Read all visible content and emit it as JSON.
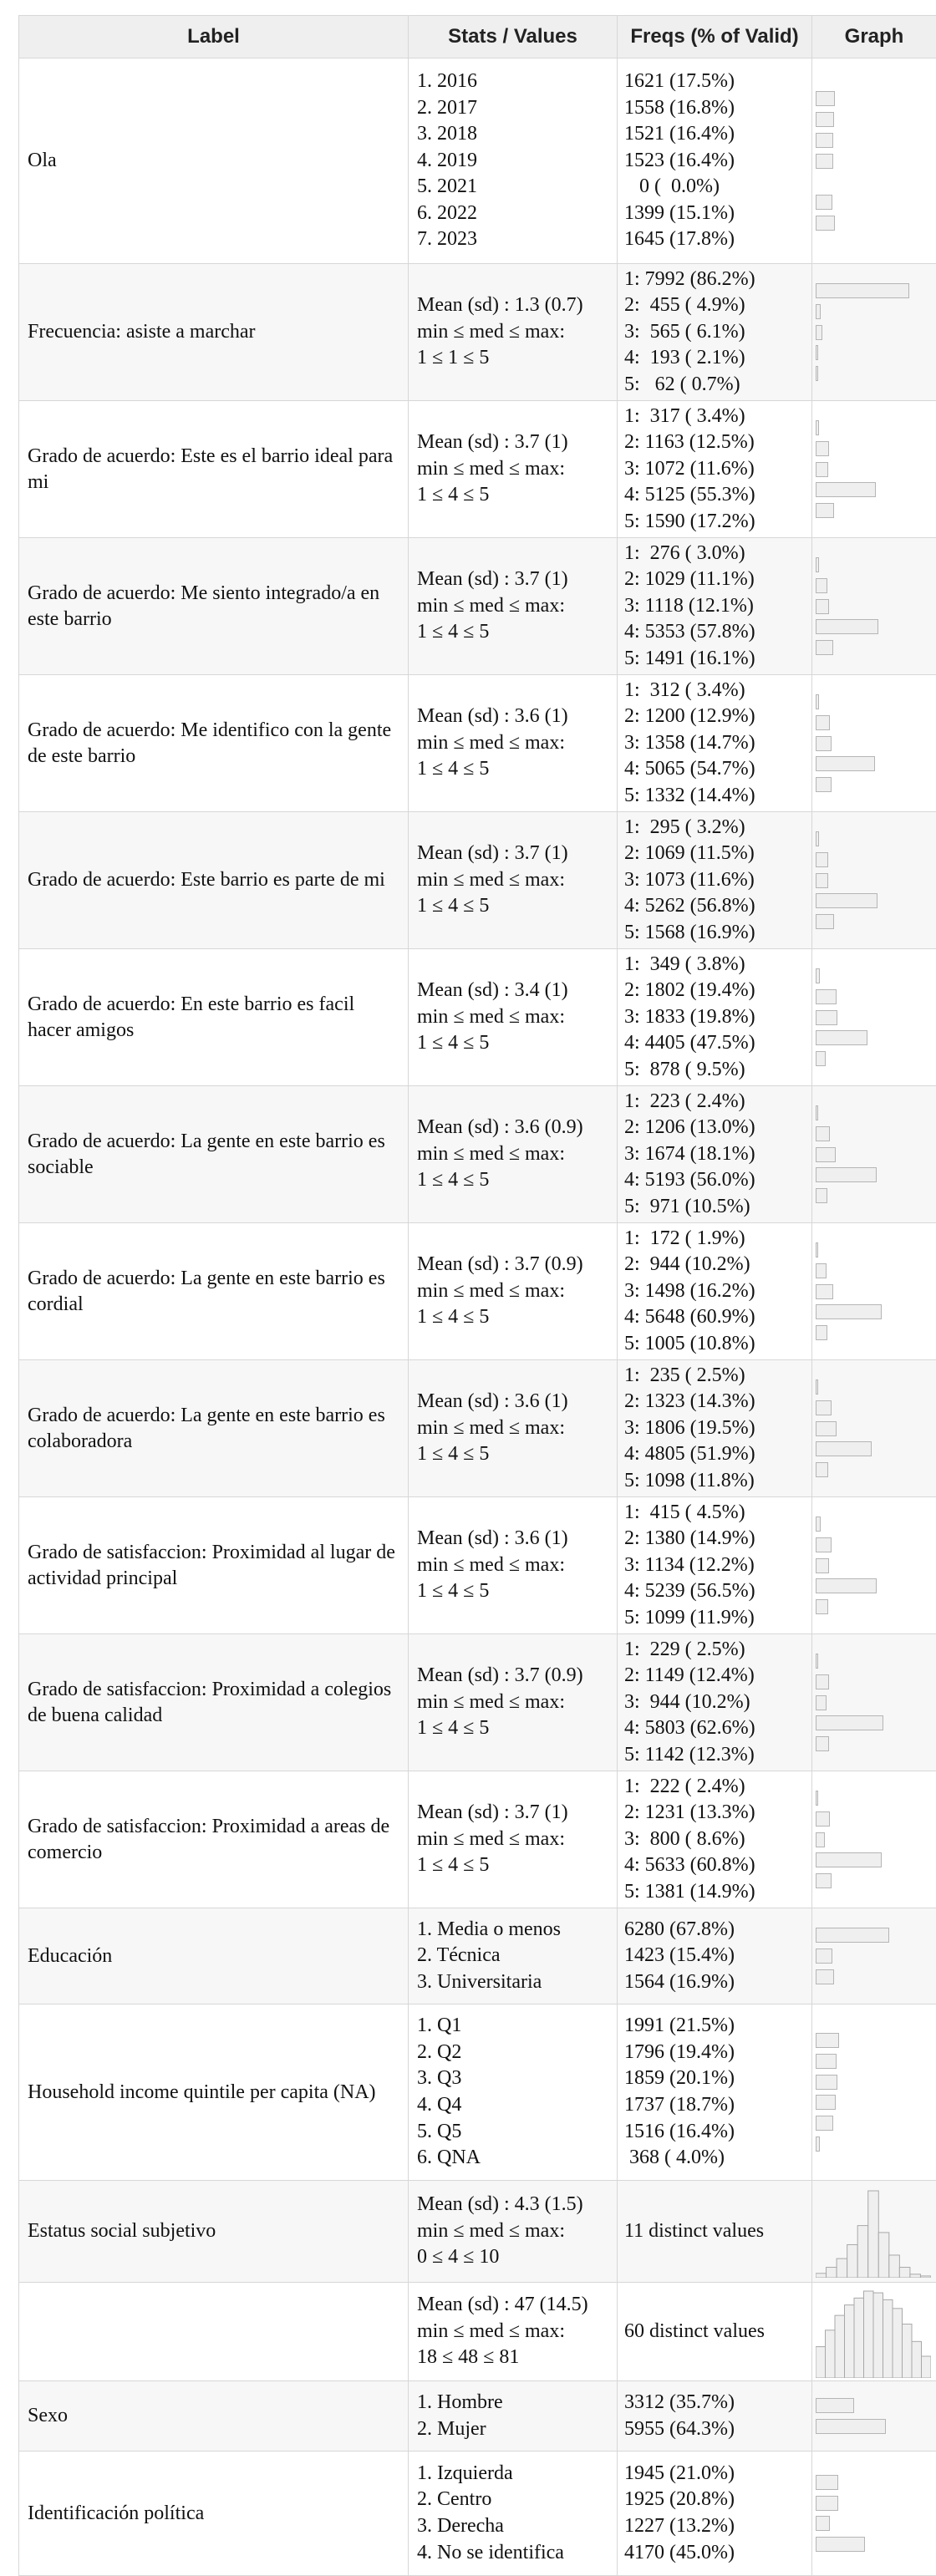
{
  "headers": {
    "label": "Label",
    "stats": "Stats / Values",
    "freqs": "Freqs (% of Valid)",
    "graph": "Graph"
  },
  "rows": [
    {
      "label": "Ola",
      "stats": [
        "1. 2016",
        "2. 2017",
        "3. 2018",
        "4. 2019",
        "5. 2021",
        "6. 2022",
        "7. 2023"
      ],
      "freqs": [
        "1621 (17.5%)",
        "1558 (16.8%)",
        "1521 (16.4%)",
        "1523 (16.4%)",
        "   0 (  0.0%)",
        "1399 (15.1%)",
        "1645 (17.8%)"
      ],
      "bars": [
        0.175,
        0.168,
        0.164,
        0.164,
        0.0,
        0.151,
        0.178
      ]
    },
    {
      "label": "Frecuencia: asiste a marchar",
      "stats": [
        "Mean (sd) : 1.3 (0.7)",
        "min ≤ med ≤ max:",
        "1 ≤ 1 ≤ 5"
      ],
      "freqs": [
        "1: 7992 (86.2%)",
        "2:  455 ( 4.9%)",
        "3:  565 ( 6.1%)",
        "4:  193 ( 2.1%)",
        "5:   62 ( 0.7%)"
      ],
      "bars": [
        0.862,
        0.049,
        0.061,
        0.021,
        0.007
      ]
    },
    {
      "label": "Grado de acuerdo: Este es el barrio ideal para mi",
      "stats": [
        "Mean (sd) : 3.7 (1)",
        "min ≤ med ≤ max:",
        "1 ≤ 4 ≤ 5"
      ],
      "freqs": [
        "1:  317 ( 3.4%)",
        "2: 1163 (12.5%)",
        "3: 1072 (11.6%)",
        "4: 5125 (55.3%)",
        "5: 1590 (17.2%)"
      ],
      "bars": [
        0.034,
        0.125,
        0.116,
        0.553,
        0.172
      ]
    },
    {
      "label": "Grado de acuerdo: Me siento integrado/a en este barrio",
      "stats": [
        "Mean (sd) : 3.7 (1)",
        "min ≤ med ≤ max:",
        "1 ≤ 4 ≤ 5"
      ],
      "freqs": [
        "1:  276 ( 3.0%)",
        "2: 1029 (11.1%)",
        "3: 1118 (12.1%)",
        "4: 5353 (57.8%)",
        "5: 1491 (16.1%)"
      ],
      "bars": [
        0.03,
        0.111,
        0.121,
        0.578,
        0.161
      ]
    },
    {
      "label": "Grado de acuerdo: Me identifico con la gente de este barrio",
      "stats": [
        "Mean (sd) : 3.6 (1)",
        "min ≤ med ≤ max:",
        "1 ≤ 4 ≤ 5"
      ],
      "freqs": [
        "1:  312 ( 3.4%)",
        "2: 1200 (12.9%)",
        "3: 1358 (14.7%)",
        "4: 5065 (54.7%)",
        "5: 1332 (14.4%)"
      ],
      "bars": [
        0.034,
        0.129,
        0.147,
        0.547,
        0.144
      ]
    },
    {
      "label": "Grado de acuerdo: Este barrio es parte de mi",
      "stats": [
        "Mean (sd) : 3.7 (1)",
        "min ≤ med ≤ max:",
        "1 ≤ 4 ≤ 5"
      ],
      "freqs": [
        "1:  295 ( 3.2%)",
        "2: 1069 (11.5%)",
        "3: 1073 (11.6%)",
        "4: 5262 (56.8%)",
        "5: 1568 (16.9%)"
      ],
      "bars": [
        0.032,
        0.115,
        0.116,
        0.568,
        0.169
      ]
    },
    {
      "label": "Grado de acuerdo: En este barrio es facil hacer amigos",
      "stats": [
        "Mean (sd) : 3.4 (1)",
        "min ≤ med ≤ max:",
        "1 ≤ 4 ≤ 5"
      ],
      "freqs": [
        "1:  349 ( 3.8%)",
        "2: 1802 (19.4%)",
        "3: 1833 (19.8%)",
        "4: 4405 (47.5%)",
        "5:  878 ( 9.5%)"
      ],
      "bars": [
        0.038,
        0.194,
        0.198,
        0.475,
        0.095
      ]
    },
    {
      "label": "Grado de acuerdo: La gente en este barrio es sociable",
      "stats": [
        "Mean (sd) : 3.6 (0.9)",
        "min ≤ med ≤ max:",
        "1 ≤ 4 ≤ 5"
      ],
      "freqs": [
        "1:  223 ( 2.4%)",
        "2: 1206 (13.0%)",
        "3: 1674 (18.1%)",
        "4: 5193 (56.0%)",
        "5:  971 (10.5%)"
      ],
      "bars": [
        0.024,
        0.13,
        0.181,
        0.56,
        0.105
      ]
    },
    {
      "label": "Grado de acuerdo: La gente en este barrio es cordial",
      "stats": [
        "Mean (sd) : 3.7 (0.9)",
        "min ≤ med ≤ max:",
        "1 ≤ 4 ≤ 5"
      ],
      "freqs": [
        "1:  172 ( 1.9%)",
        "2:  944 (10.2%)",
        "3: 1498 (16.2%)",
        "4: 5648 (60.9%)",
        "5: 1005 (10.8%)"
      ],
      "bars": [
        0.019,
        0.102,
        0.162,
        0.609,
        0.108
      ]
    },
    {
      "label": "Grado de acuerdo: La gente en este barrio es colaboradora",
      "stats": [
        "Mean (sd) : 3.6 (1)",
        "min ≤ med ≤ max:",
        "1 ≤ 4 ≤ 5"
      ],
      "freqs": [
        "1:  235 ( 2.5%)",
        "2: 1323 (14.3%)",
        "3: 1806 (19.5%)",
        "4: 4805 (51.9%)",
        "5: 1098 (11.8%)"
      ],
      "bars": [
        0.025,
        0.143,
        0.195,
        0.519,
        0.118
      ]
    },
    {
      "label": "Grado de satisfaccion: Proximidad al lugar de actividad principal",
      "stats": [
        "Mean (sd) : 3.6 (1)",
        "min ≤ med ≤ max:",
        "1 ≤ 4 ≤ 5"
      ],
      "freqs": [
        "1:  415 ( 4.5%)",
        "2: 1380 (14.9%)",
        "3: 1134 (12.2%)",
        "4: 5239 (56.5%)",
        "5: 1099 (11.9%)"
      ],
      "bars": [
        0.045,
        0.149,
        0.122,
        0.565,
        0.119
      ]
    },
    {
      "label": "Grado de satisfaccion: Proximidad a colegios de buena calidad",
      "stats": [
        "Mean (sd) : 3.7 (0.9)",
        "min ≤ med ≤ max:",
        "1 ≤ 4 ≤ 5"
      ],
      "freqs": [
        "1:  229 ( 2.5%)",
        "2: 1149 (12.4%)",
        "3:  944 (10.2%)",
        "4: 5803 (62.6%)",
        "5: 1142 (12.3%)"
      ],
      "bars": [
        0.025,
        0.124,
        0.102,
        0.626,
        0.123
      ]
    },
    {
      "label": "Grado de satisfaccion: Proximidad a areas de comercio",
      "stats": [
        "Mean (sd) : 3.7 (1)",
        "min ≤ med ≤ max:",
        "1 ≤ 4 ≤ 5"
      ],
      "freqs": [
        "1:  222 ( 2.4%)",
        "2: 1231 (13.3%)",
        "3:  800 ( 8.6%)",
        "4: 5633 (60.8%)",
        "5: 1381 (14.9%)"
      ],
      "bars": [
        0.024,
        0.133,
        0.086,
        0.608,
        0.149
      ]
    },
    {
      "label": "Educación",
      "stats": [
        "1. Media o menos",
        "2. Técnica",
        "3. Universitaria"
      ],
      "freqs": [
        "6280 (67.8%)",
        "1423 (15.4%)",
        "1564 (16.9%)"
      ],
      "bars": [
        0.678,
        0.154,
        0.169
      ]
    },
    {
      "label": "Household income quintile per capita (NA)",
      "stats": [
        "1. Q1",
        "2. Q2",
        "3. Q3",
        "4. Q4",
        "5. Q5",
        "6. QNA"
      ],
      "freqs": [
        "1991 (21.5%)",
        "1796 (19.4%)",
        "1859 (20.1%)",
        "1737 (18.7%)",
        "1516 (16.4%)",
        " 368 ( 4.0%)"
      ],
      "bars": [
        0.215,
        0.194,
        0.201,
        0.187,
        0.164,
        0.04
      ]
    },
    {
      "label": "Estatus social subjetivo",
      "stats": [
        "Mean (sd) : 4.3 (1.5)",
        "min ≤ med ≤ max:",
        "0 ≤ 4 ≤ 10"
      ],
      "distinct": "11 distinct values",
      "hist": [
        0.05,
        0.12,
        0.22,
        0.38,
        0.6,
        1.0,
        0.52,
        0.26,
        0.12,
        0.04,
        0.02
      ]
    },
    {
      "label": "",
      "stats": [
        "Mean (sd) : 47 (14.5)",
        "min ≤ med ≤ max:",
        "18 ≤ 48 ≤ 81"
      ],
      "distinct": "60 distinct values",
      "hist": [
        0.36,
        0.55,
        0.72,
        0.84,
        0.92,
        1.0,
        0.98,
        0.9,
        0.8,
        0.62,
        0.42,
        0.25
      ]
    },
    {
      "label": "Sexo",
      "stats": [
        "1. Hombre",
        "2. Mujer"
      ],
      "freqs": [
        "3312 (35.7%)",
        "5955 (64.3%)"
      ],
      "bars": [
        0.357,
        0.643
      ]
    },
    {
      "label": "Identificación política",
      "stats": [
        "1. Izquierda",
        "2. Centro",
        "3. Derecha",
        "4. No se identifica"
      ],
      "freqs": [
        "1945 (21.0%)",
        "1925 (20.8%)",
        "1227 (13.2%)",
        "4170 (45.0%)"
      ],
      "bars": [
        0.21,
        0.208,
        0.132,
        0.45
      ]
    }
  ]
}
